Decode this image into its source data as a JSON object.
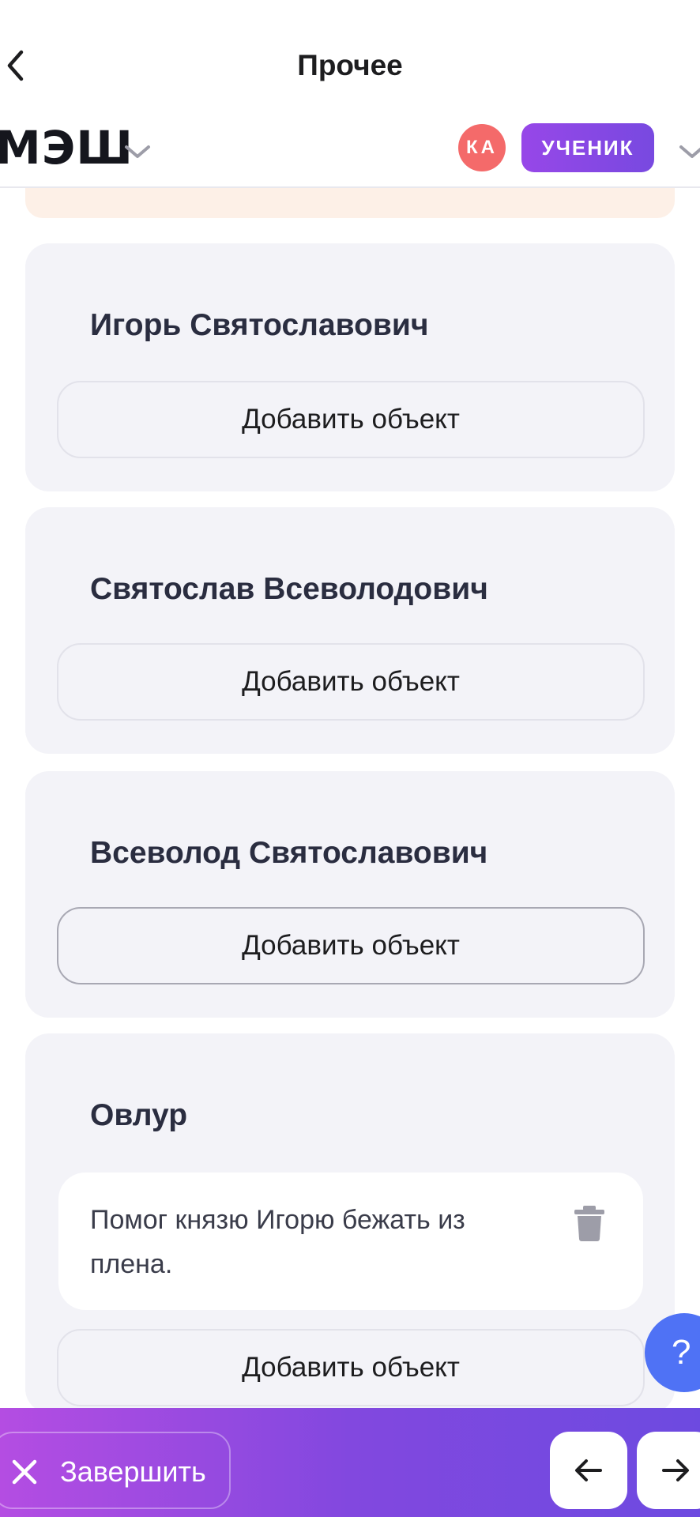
{
  "header": {
    "title": "Прочее",
    "back_icon": "chevron-left-icon"
  },
  "appbar": {
    "logo": "МЭШ",
    "avatar_initials": "КА",
    "avatar_color": "#f46a6a",
    "role": "УЧЕНИК",
    "accent": "#8a48e4"
  },
  "cards": [
    {
      "title": "Игорь Святославович",
      "add_label": "Добавить объект"
    },
    {
      "title": "Святослав Всеволодович",
      "add_label": "Добавить объект"
    },
    {
      "title": "Всеволод Святославович",
      "add_label": "Добавить объект"
    },
    {
      "title": "Овлур",
      "entry_text": "Помог князю Игорю бежать из плена.",
      "add_label": "Добавить объект"
    }
  ],
  "help": {
    "label": "?"
  },
  "footer": {
    "finish_label": "Завершить",
    "prev_icon": "arrow-left-icon",
    "next_icon": "arrow-right-icon"
  }
}
